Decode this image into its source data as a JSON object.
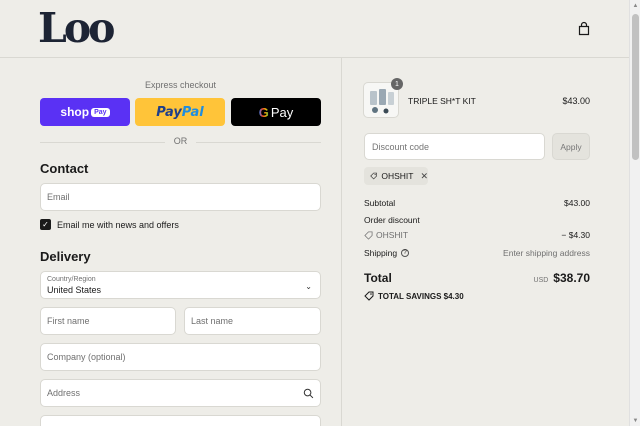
{
  "header": {
    "logo": "Loo",
    "cart_icon": "shopping-bag-icon"
  },
  "express": {
    "label": "Express checkout",
    "shop_pay": {
      "text": "shop",
      "pill": "Pay"
    },
    "paypal": {
      "part1": "Pay",
      "part2": "Pal"
    },
    "gpay": {
      "g": "G",
      "text": "Pay"
    },
    "or": "OR"
  },
  "contact": {
    "title": "Contact",
    "email_placeholder": "Email",
    "newsletter_label": "Email me with news and offers",
    "newsletter_checked": true
  },
  "delivery": {
    "title": "Delivery",
    "country_label": "Country/Region",
    "country_value": "United States",
    "first_name_placeholder": "First name",
    "last_name_placeholder": "Last name",
    "company_placeholder": "Company (optional)",
    "address_placeholder": "Address"
  },
  "summary": {
    "item": {
      "quantity": "1",
      "name": "TRIPLE SH*T KIT",
      "price": "$43.00"
    },
    "discount_placeholder": "Discount code",
    "apply_label": "Apply",
    "applied_code": "OHSHIT",
    "subtotal_label": "Subtotal",
    "subtotal_value": "$43.00",
    "order_discount_label": "Order discount",
    "order_discount_code": "OHSHIT",
    "order_discount_value": "− $4.30",
    "shipping_label": "Shipping",
    "shipping_value": "Enter shipping address",
    "total_label": "Total",
    "currency": "USD",
    "total_value": "$38.70",
    "savings_label": "TOTAL SAVINGS $4.30"
  },
  "colors": {
    "background": "#eeede8",
    "shop_pay": "#5a31f4",
    "paypal": "#ffc439",
    "gpay": "#000000",
    "logo": "#1d2434"
  }
}
